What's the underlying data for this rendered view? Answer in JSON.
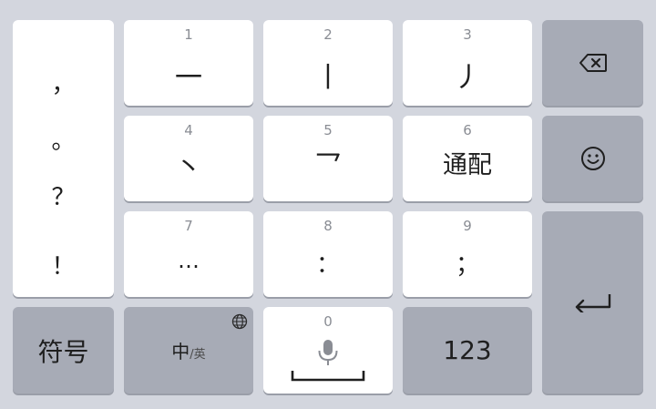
{
  "punctuation": {
    "comma": "，",
    "period": "。",
    "question": "？",
    "exclaim": "！"
  },
  "keys": [
    {
      "num": "1",
      "label": "一"
    },
    {
      "num": "2",
      "label": "丨"
    },
    {
      "num": "3",
      "label": "丿"
    },
    {
      "num": "4",
      "label": "丶"
    },
    {
      "num": "5",
      "label": "乛"
    },
    {
      "num": "6",
      "label": "通配"
    },
    {
      "num": "7",
      "label": "…"
    },
    {
      "num": "8",
      "label": "："
    },
    {
      "num": "9",
      "label": "；"
    }
  ],
  "bottom": {
    "symbols": "符号",
    "lang_main": "中",
    "lang_alt": "/英",
    "space_num": "0",
    "numbers": "123"
  },
  "icons": {
    "backspace": "backspace-icon",
    "emoji": "emoji-icon",
    "enter": "enter-icon",
    "globe": "globe-icon",
    "mic": "microphone-icon"
  },
  "colors": {
    "background": "#d3d6de",
    "key_light": "#ffffff",
    "key_dark": "#a7abb6"
  }
}
